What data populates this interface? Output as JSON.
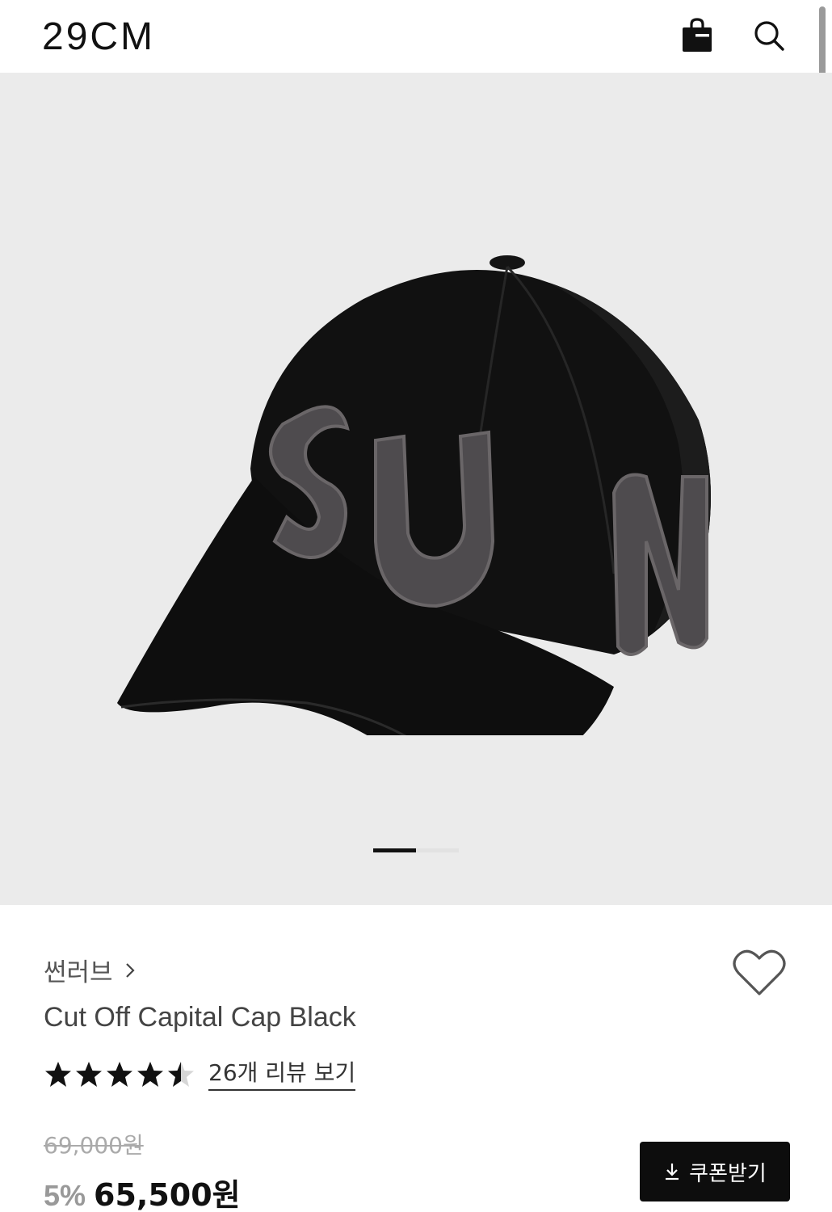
{
  "header": {
    "logo": "29CM",
    "icons": {
      "bag": "shopping-bag-icon",
      "search": "search-icon"
    }
  },
  "gallery": {
    "image": "product-photo-black-cap",
    "patch_text": "SUN",
    "slide_progress": 0.5
  },
  "product": {
    "brand": "썬러브",
    "name": "Cut Off Capital Cap Black",
    "rating": 4.5,
    "review_link": "26개 리뷰 보기",
    "original_price": "69,000원",
    "discount": "5%",
    "sale_price": "65,500원",
    "coupon_button": "쿠폰받기"
  },
  "colors": {
    "accent": "#0d0d0d",
    "gallery_bg": "#ebebeb",
    "discount": "#999999"
  }
}
